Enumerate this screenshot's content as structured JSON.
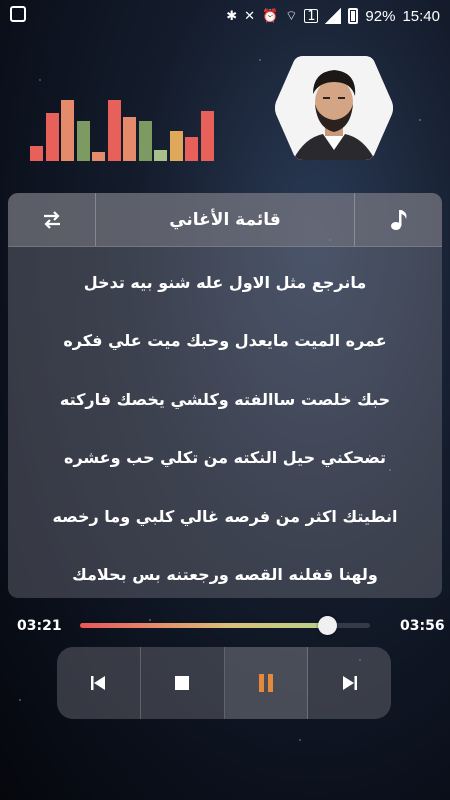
{
  "status": {
    "battery": "92%",
    "time": "15:40",
    "notification_count": "1"
  },
  "equalizer": {
    "bars": [
      {
        "level": 0.22,
        "color": "#e8605a"
      },
      {
        "level": 0.72,
        "color": "#e8605a"
      },
      {
        "level": 0.92,
        "color": "#e58a6a"
      },
      {
        "level": 0.6,
        "color": "#7d9a62"
      },
      {
        "level": 0.14,
        "color": "#e58a6a"
      },
      {
        "level": 0.92,
        "color": "#e8605a"
      },
      {
        "level": 0.66,
        "color": "#e58a6a"
      },
      {
        "level": 0.6,
        "color": "#7d9a62"
      },
      {
        "level": 0.16,
        "color": "#a8c08a"
      },
      {
        "level": 0.46,
        "color": "#e0a85a"
      },
      {
        "level": 0.36,
        "color": "#e8605a"
      },
      {
        "level": 0.76,
        "color": "#e8605a"
      }
    ]
  },
  "playlist": {
    "title": "قائمة الأغاني",
    "repeat_icon": "repeat-icon",
    "music_icon": "music-note-icon"
  },
  "lyrics": [
    "مانرجع مثل الاول عله شنو بيه تدخل",
    "عمره الميت مايعدل وحبك ميت علي فكره",
    "حبك خلصت ساالفته وكلشي يخصك فاركته",
    "تضحكني حيل النكته من تكلي حب وعشره",
    "انطيتك اكثر من فرصه غالي كلبي وما رخصه",
    "ولهنا قفلنه القصه ورجعتنه بس بحلامك"
  ],
  "player": {
    "current_time": "03:21",
    "total_time": "03:56",
    "progress": 0.85,
    "accent": "#e58a3a"
  },
  "controls": {
    "prev_icon": "skip-previous-icon",
    "stop_icon": "stop-icon",
    "pause_icon": "pause-icon",
    "next_icon": "skip-next-icon"
  }
}
